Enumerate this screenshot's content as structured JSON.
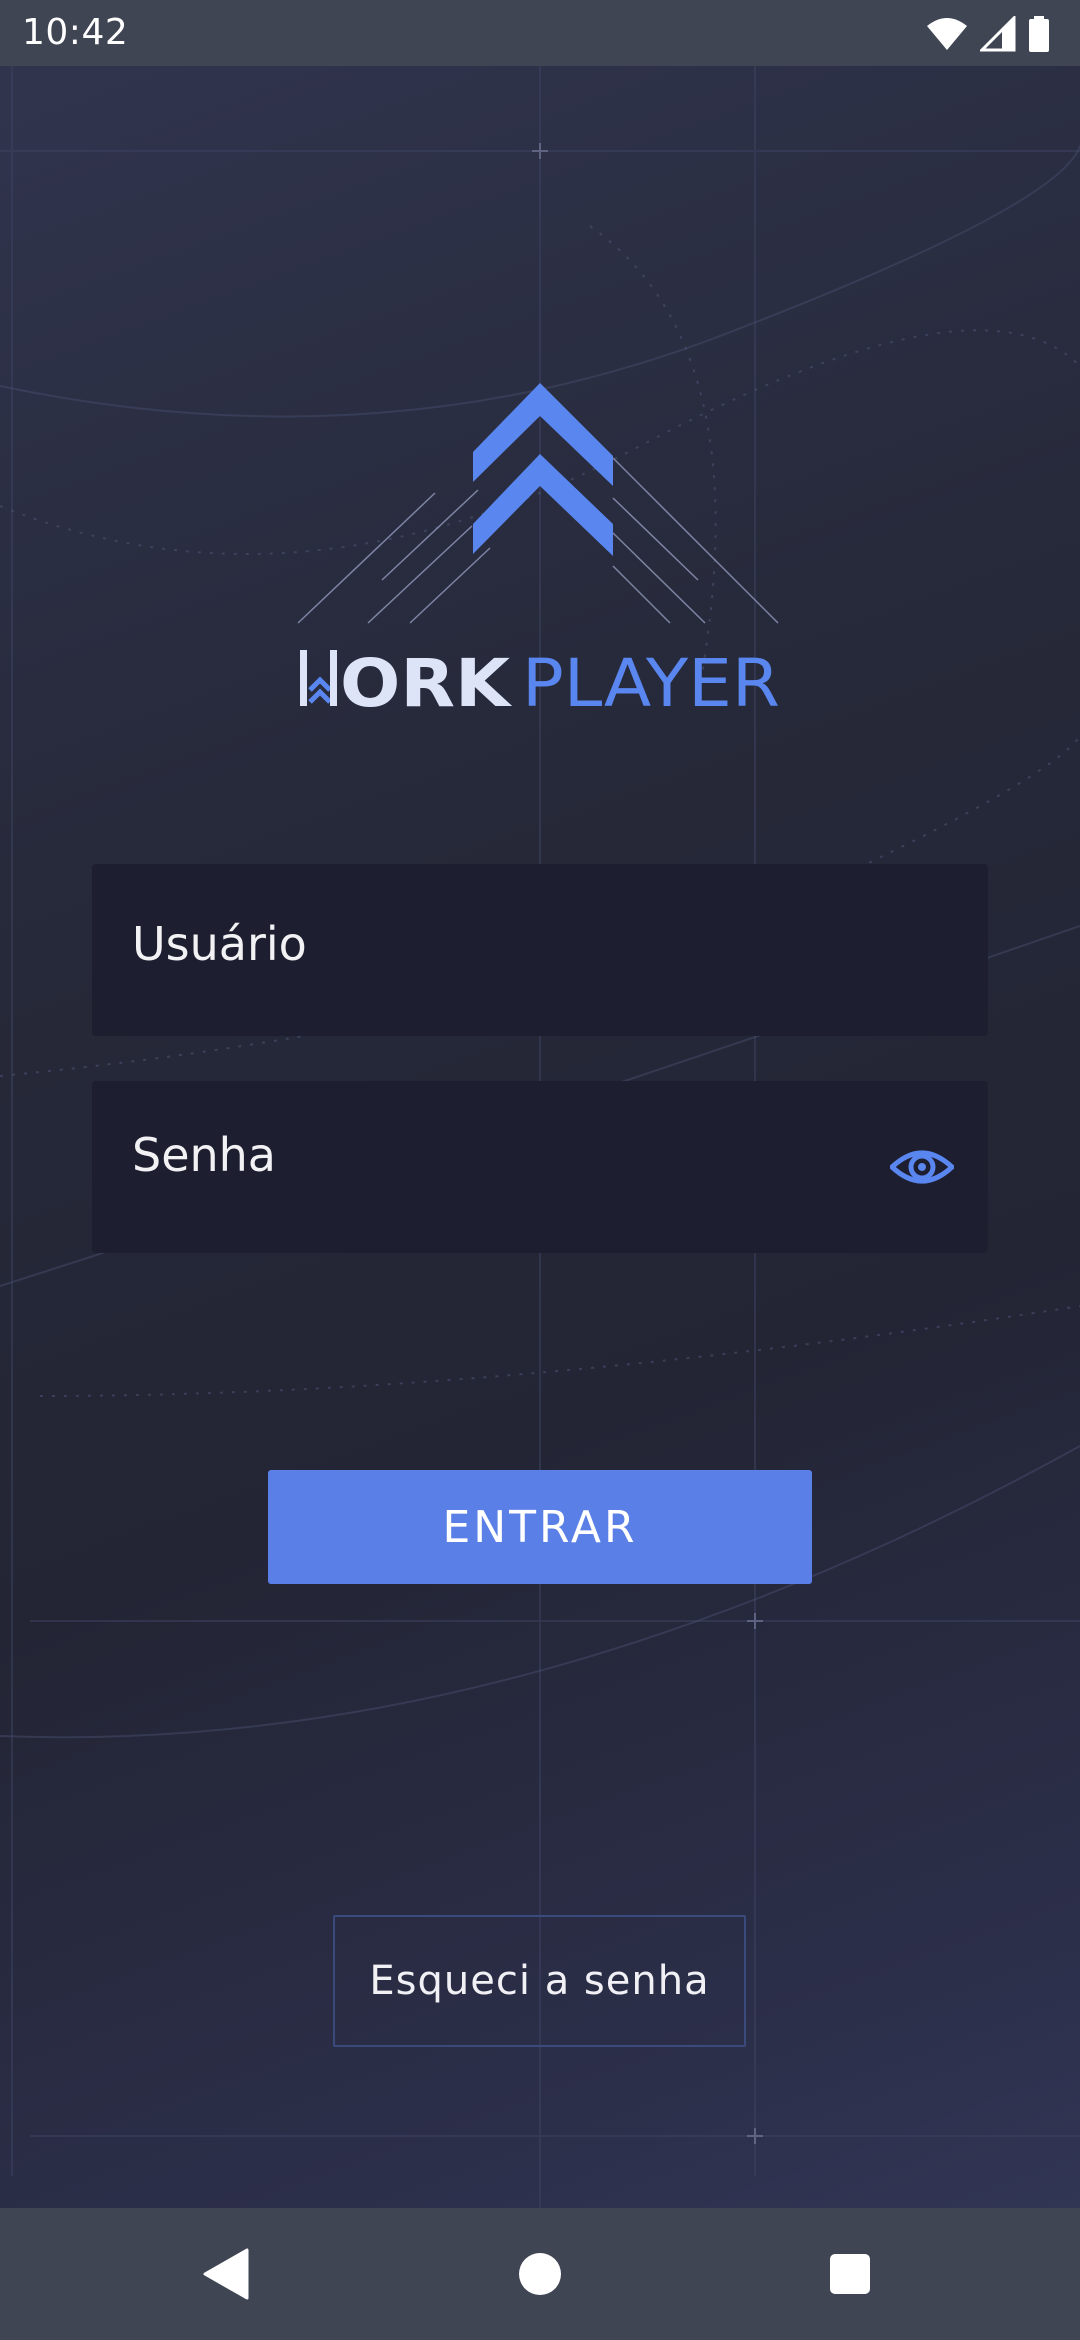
{
  "status_bar": {
    "time": "10:42",
    "icons": [
      "wifi-icon",
      "signal-icon",
      "battery-icon"
    ]
  },
  "logo": {
    "word_left": "WORK",
    "word_right": "PLAYER"
  },
  "form": {
    "username_placeholder": "Usuário",
    "password_placeholder": "Senha",
    "password_toggle_icon": "eye-icon"
  },
  "actions": {
    "login_label": "ENTRAR",
    "forgot_label": "Esqueci a senha"
  },
  "nav_bar": {
    "icons": [
      "back-icon",
      "home-icon",
      "recents-icon"
    ]
  },
  "colors": {
    "accent": "#5a7fe6",
    "logo_light": "#dde4f8",
    "field_bg": "#1d1e2f",
    "bar_bg": "#3f4553"
  }
}
